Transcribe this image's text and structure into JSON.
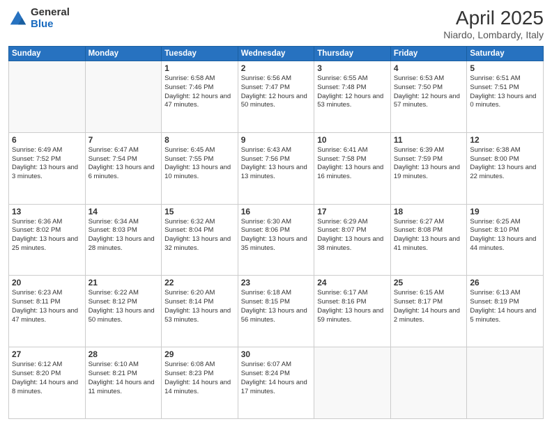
{
  "header": {
    "logo_general": "General",
    "logo_blue": "Blue",
    "month_title": "April 2025",
    "location": "Niardo, Lombardy, Italy"
  },
  "days_of_week": [
    "Sunday",
    "Monday",
    "Tuesday",
    "Wednesday",
    "Thursday",
    "Friday",
    "Saturday"
  ],
  "weeks": [
    [
      {
        "num": "",
        "info": ""
      },
      {
        "num": "",
        "info": ""
      },
      {
        "num": "1",
        "info": "Sunrise: 6:58 AM\nSunset: 7:46 PM\nDaylight: 12 hours and 47 minutes."
      },
      {
        "num": "2",
        "info": "Sunrise: 6:56 AM\nSunset: 7:47 PM\nDaylight: 12 hours and 50 minutes."
      },
      {
        "num": "3",
        "info": "Sunrise: 6:55 AM\nSunset: 7:48 PM\nDaylight: 12 hours and 53 minutes."
      },
      {
        "num": "4",
        "info": "Sunrise: 6:53 AM\nSunset: 7:50 PM\nDaylight: 12 hours and 57 minutes."
      },
      {
        "num": "5",
        "info": "Sunrise: 6:51 AM\nSunset: 7:51 PM\nDaylight: 13 hours and 0 minutes."
      }
    ],
    [
      {
        "num": "6",
        "info": "Sunrise: 6:49 AM\nSunset: 7:52 PM\nDaylight: 13 hours and 3 minutes."
      },
      {
        "num": "7",
        "info": "Sunrise: 6:47 AM\nSunset: 7:54 PM\nDaylight: 13 hours and 6 minutes."
      },
      {
        "num": "8",
        "info": "Sunrise: 6:45 AM\nSunset: 7:55 PM\nDaylight: 13 hours and 10 minutes."
      },
      {
        "num": "9",
        "info": "Sunrise: 6:43 AM\nSunset: 7:56 PM\nDaylight: 13 hours and 13 minutes."
      },
      {
        "num": "10",
        "info": "Sunrise: 6:41 AM\nSunset: 7:58 PM\nDaylight: 13 hours and 16 minutes."
      },
      {
        "num": "11",
        "info": "Sunrise: 6:39 AM\nSunset: 7:59 PM\nDaylight: 13 hours and 19 minutes."
      },
      {
        "num": "12",
        "info": "Sunrise: 6:38 AM\nSunset: 8:00 PM\nDaylight: 13 hours and 22 minutes."
      }
    ],
    [
      {
        "num": "13",
        "info": "Sunrise: 6:36 AM\nSunset: 8:02 PM\nDaylight: 13 hours and 25 minutes."
      },
      {
        "num": "14",
        "info": "Sunrise: 6:34 AM\nSunset: 8:03 PM\nDaylight: 13 hours and 28 minutes."
      },
      {
        "num": "15",
        "info": "Sunrise: 6:32 AM\nSunset: 8:04 PM\nDaylight: 13 hours and 32 minutes."
      },
      {
        "num": "16",
        "info": "Sunrise: 6:30 AM\nSunset: 8:06 PM\nDaylight: 13 hours and 35 minutes."
      },
      {
        "num": "17",
        "info": "Sunrise: 6:29 AM\nSunset: 8:07 PM\nDaylight: 13 hours and 38 minutes."
      },
      {
        "num": "18",
        "info": "Sunrise: 6:27 AM\nSunset: 8:08 PM\nDaylight: 13 hours and 41 minutes."
      },
      {
        "num": "19",
        "info": "Sunrise: 6:25 AM\nSunset: 8:10 PM\nDaylight: 13 hours and 44 minutes."
      }
    ],
    [
      {
        "num": "20",
        "info": "Sunrise: 6:23 AM\nSunset: 8:11 PM\nDaylight: 13 hours and 47 minutes."
      },
      {
        "num": "21",
        "info": "Sunrise: 6:22 AM\nSunset: 8:12 PM\nDaylight: 13 hours and 50 minutes."
      },
      {
        "num": "22",
        "info": "Sunrise: 6:20 AM\nSunset: 8:14 PM\nDaylight: 13 hours and 53 minutes."
      },
      {
        "num": "23",
        "info": "Sunrise: 6:18 AM\nSunset: 8:15 PM\nDaylight: 13 hours and 56 minutes."
      },
      {
        "num": "24",
        "info": "Sunrise: 6:17 AM\nSunset: 8:16 PM\nDaylight: 13 hours and 59 minutes."
      },
      {
        "num": "25",
        "info": "Sunrise: 6:15 AM\nSunset: 8:17 PM\nDaylight: 14 hours and 2 minutes."
      },
      {
        "num": "26",
        "info": "Sunrise: 6:13 AM\nSunset: 8:19 PM\nDaylight: 14 hours and 5 minutes."
      }
    ],
    [
      {
        "num": "27",
        "info": "Sunrise: 6:12 AM\nSunset: 8:20 PM\nDaylight: 14 hours and 8 minutes."
      },
      {
        "num": "28",
        "info": "Sunrise: 6:10 AM\nSunset: 8:21 PM\nDaylight: 14 hours and 11 minutes."
      },
      {
        "num": "29",
        "info": "Sunrise: 6:08 AM\nSunset: 8:23 PM\nDaylight: 14 hours and 14 minutes."
      },
      {
        "num": "30",
        "info": "Sunrise: 6:07 AM\nSunset: 8:24 PM\nDaylight: 14 hours and 17 minutes."
      },
      {
        "num": "",
        "info": ""
      },
      {
        "num": "",
        "info": ""
      },
      {
        "num": "",
        "info": ""
      }
    ]
  ]
}
